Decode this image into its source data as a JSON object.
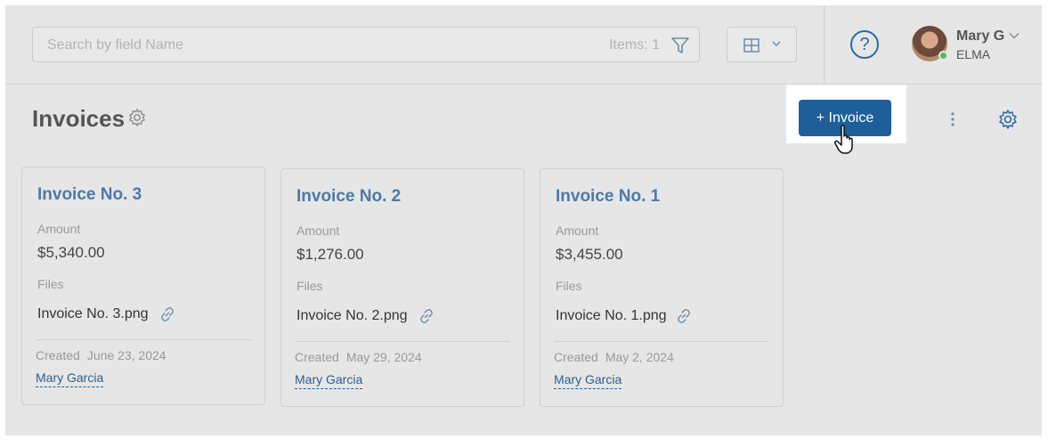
{
  "topbar": {
    "search_placeholder": "Search by field Name",
    "items_count": "Items: 1",
    "filter_icon": "funnel-icon",
    "view_icon": "grid-icon",
    "help_icon": "help-circle-icon",
    "help_glyph": "?",
    "user": {
      "name": "Mary G",
      "company": "ELMA",
      "status_color": "#5cb85c"
    }
  },
  "header": {
    "title": "Invoices",
    "add_button": "+ Invoice",
    "accent_color": "#1f5f99"
  },
  "cards": [
    {
      "title": "Invoice No. 3",
      "amount_label": "Amount",
      "amount": "$5,340.00",
      "files_label": "Files",
      "file": "Invoice No. 3.png",
      "created_label": "Created",
      "created_date": "June 23, 2024",
      "author": "Mary Garcia"
    },
    {
      "title": "Invoice No. 2",
      "amount_label": "Amount",
      "amount": "$1,276.00",
      "files_label": "Files",
      "file": "Invoice No. 2.png",
      "created_label": "Created",
      "created_date": "May 29, 2024",
      "author": "Mary Garcia"
    },
    {
      "title": "Invoice No. 1",
      "amount_label": "Amount",
      "amount": "$3,455.00",
      "files_label": "Files",
      "file": "Invoice No. 1.png",
      "created_label": "Created",
      "created_date": "May 2, 2024",
      "author": "Mary Garcia"
    }
  ]
}
